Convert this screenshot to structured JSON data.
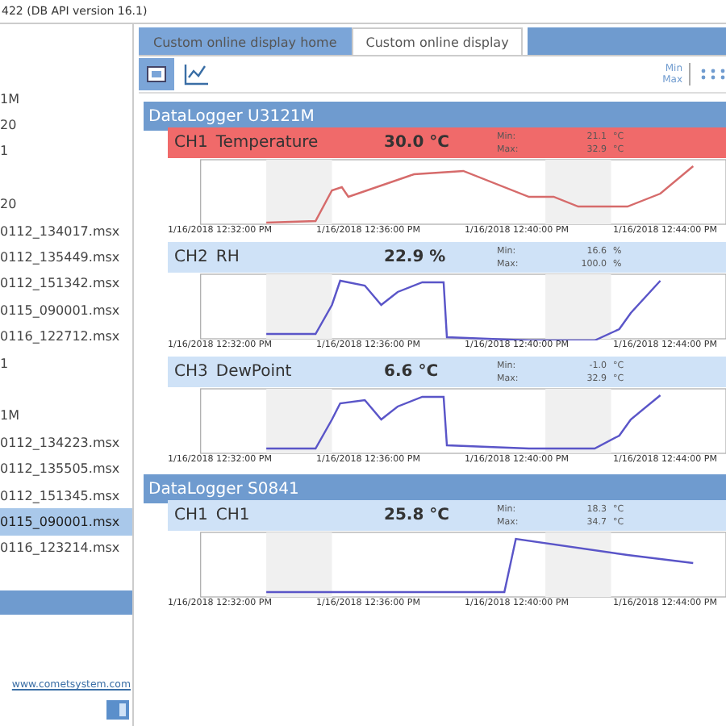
{
  "window": {
    "title": "422 (DB API version 16.1)"
  },
  "sidebar": {
    "items": [
      {
        "label": "1M",
        "selected": false
      },
      {
        "label": "20",
        "selected": false
      },
      {
        "label": "1",
        "selected": false
      },
      {
        "label": "20",
        "selected": false,
        "gap_before": true
      },
      {
        "label": "0112_134017.msx",
        "selected": false
      },
      {
        "label": "0112_135449.msx",
        "selected": false
      },
      {
        "label": "0112_151342.msx",
        "selected": false
      },
      {
        "label": "0115_090001.msx",
        "selected": false
      },
      {
        "label": "0116_122712.msx",
        "selected": false
      },
      {
        "label": "1",
        "selected": false
      },
      {
        "label": "1M",
        "selected": false,
        "gap_before": true
      },
      {
        "label": "0112_134223.msx",
        "selected": false
      },
      {
        "label": "0112_135505.msx",
        "selected": false
      },
      {
        "label": "0112_151345.msx",
        "selected": false
      },
      {
        "label": "0115_090001.msx",
        "selected": true
      },
      {
        "label": "0116_123214.msx",
        "selected": false
      }
    ],
    "link": "www.cometsystem.com"
  },
  "tabs": [
    {
      "label": "Custom online display home",
      "selected": false
    },
    {
      "label": "Custom online display",
      "selected": true
    }
  ],
  "toolbar": {
    "min_max": [
      "Min",
      "Max"
    ]
  },
  "loggers": [
    {
      "name": "DataLogger U3121M",
      "channels": [
        {
          "id": "CH1",
          "name": "Temperature",
          "value": "30.0 °C",
          "alarm": true,
          "min_label": "Min:",
          "min": "21.1",
          "min_unit": "°C",
          "max_label": "Max:",
          "max": "32.9",
          "max_unit": "°C",
          "time_labels": [
            "1/16/2018 12:32:00 PM",
            "1/16/2018 12:36:00 PM",
            "1/16/2018 12:40:00 PM",
            "1/16/2018 12:44:00 PM"
          ]
        },
        {
          "id": "CH2",
          "name": "RH",
          "value": "22.9 %",
          "alarm": false,
          "min_label": "Min:",
          "min": "16.6",
          "min_unit": "%",
          "max_label": "Max:",
          "max": "100.0",
          "max_unit": "%",
          "time_labels": [
            "1/16/2018 12:32:00 PM",
            "1/16/2018 12:36:00 PM",
            "1/16/2018 12:40:00 PM",
            "1/16/2018 12:44:00 PM"
          ]
        },
        {
          "id": "CH3",
          "name": "DewPoint",
          "value": "6.6 °C",
          "alarm": false,
          "min_label": "Min:",
          "min": "-1.0",
          "min_unit": "°C",
          "max_label": "Max:",
          "max": "32.9",
          "max_unit": "°C",
          "time_labels": [
            "1/16/2018 12:32:00 PM",
            "1/16/2018 12:36:00 PM",
            "1/16/2018 12:40:00 PM",
            "1/16/2018 12:44:00 PM"
          ]
        }
      ]
    },
    {
      "name": "DataLogger S0841",
      "channels": [
        {
          "id": "CH1",
          "name": "CH1",
          "value": "25.8 °C",
          "alarm": false,
          "min_label": "Min:",
          "min": "18.3",
          "min_unit": "°C",
          "max_label": "Max:",
          "max": "34.7",
          "max_unit": "°C",
          "time_labels": [
            "1/16/2018 12:32:00 PM",
            "1/16/2018 12:36:00 PM",
            "1/16/2018 12:40:00 PM",
            "1/16/2018 12:44:00 PM"
          ]
        }
      ]
    }
  ]
}
